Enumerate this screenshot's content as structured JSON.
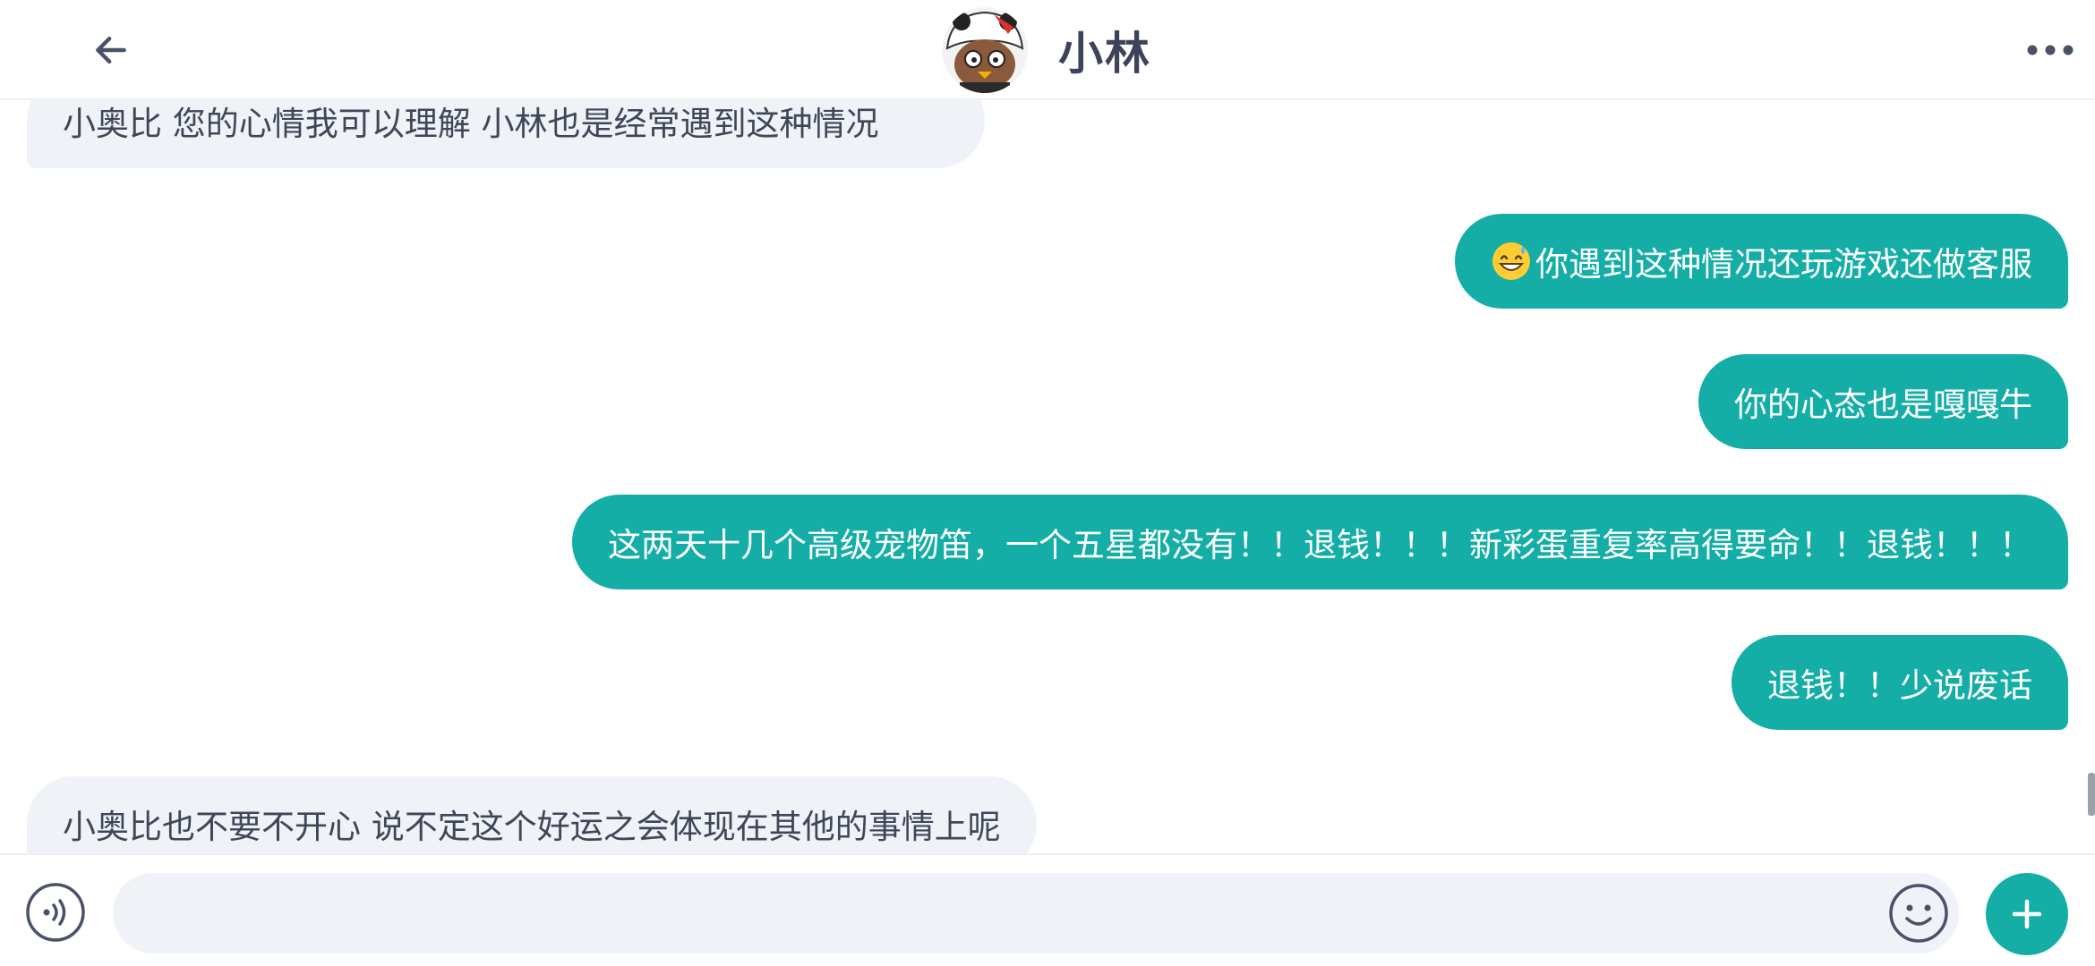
{
  "header": {
    "title": "小林",
    "back_icon": "arrow-left-icon",
    "more_icon": "more-horizontal-icon",
    "avatar_icon": "panda-avatar"
  },
  "messages": [
    {
      "side": "in",
      "text": "小奥比 您的心情我可以理解 小林也是经常遇到这种情况"
    },
    {
      "side": "out",
      "emoji": "grinning-sweat-emoji",
      "text": "你遇到这种情况还玩游戏还做客服"
    },
    {
      "side": "out",
      "text": "你的心态也是嘎嘎牛"
    },
    {
      "side": "out",
      "text": "这两天十几个高级宠物笛，一个五星都没有！！退钱！！！新彩蛋重复率高得要命！！退钱！！！"
    },
    {
      "side": "out",
      "text": "退钱！！少说废话"
    },
    {
      "side": "in",
      "text": "小奥比也不要不开心 说不定这个好运之会体现在其他的事情上呢"
    }
  ],
  "input_bar": {
    "placeholder": "",
    "voice_icon": "voice-input-icon",
    "emoji_icon": "smiley-icon",
    "plus_icon": "plus-icon"
  },
  "colors": {
    "accent": "#14aea7",
    "incoming_bubble": "#eff2f6",
    "text_dark": "#3f4658"
  }
}
